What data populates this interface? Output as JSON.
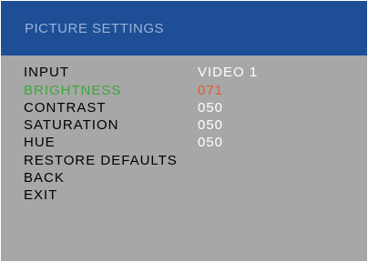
{
  "header": {
    "title": "PICTURE SETTINGS"
  },
  "menu": {
    "items": [
      {
        "label": "INPUT",
        "value": "VIDEO 1"
      },
      {
        "label": "BRIGHTNESS",
        "value": "071",
        "selected": true
      },
      {
        "label": "CONTRAST",
        "value": "050"
      },
      {
        "label": "SATURATION",
        "value": "050"
      },
      {
        "label": "HUE",
        "value": "050"
      },
      {
        "label": "RESTORE DEFAULTS"
      },
      {
        "label": "BACK"
      },
      {
        "label": "EXIT"
      }
    ]
  },
  "colors": {
    "header_bg": "#1d4e96",
    "header_text": "#9bb3d8",
    "panel_bg": "#a7a7a7",
    "label_text": "#000000",
    "value_text": "#ffffff",
    "selected_label": "#3ca63c",
    "selected_value": "#e55a2c"
  }
}
